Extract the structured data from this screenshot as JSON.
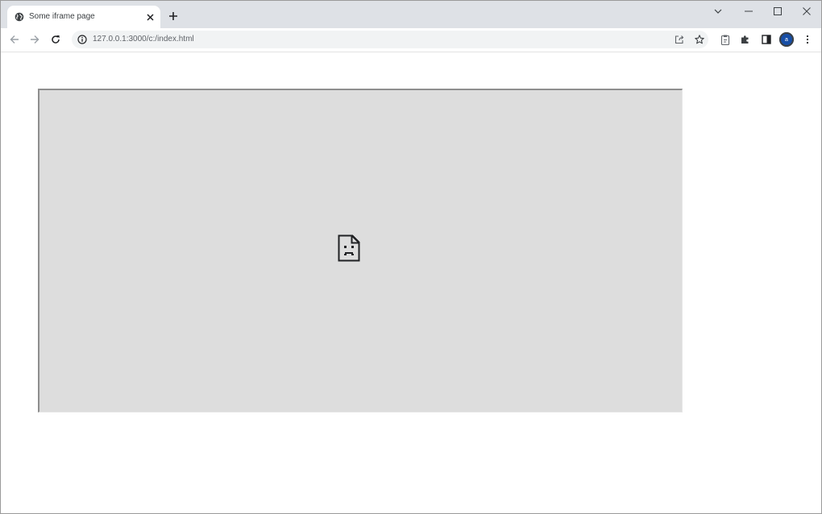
{
  "tab": {
    "title": "Some iframe page",
    "favicon": "globe-icon",
    "close_icon": "close-icon"
  },
  "tabstrip": {
    "new_tab_icon": "plus-icon",
    "search_tabs_icon": "chevron-down-icon"
  },
  "window_controls": {
    "minimize_icon": "minimize-icon",
    "maximize_icon": "maximize-icon",
    "close_icon": "close-icon"
  },
  "toolbar": {
    "back_icon": "arrow-left-icon",
    "forward_icon": "arrow-right-icon",
    "reload_icon": "reload-icon",
    "url": "127.0.0.1:3000/c:/index.html",
    "site_info_icon": "info-icon",
    "share_icon": "share-icon",
    "bookmark_icon": "star-icon",
    "extensions": [
      "clipboard-icon",
      "puzzle-icon",
      "side-panel-icon"
    ],
    "profile_initial": "a",
    "menu_icon": "kebab-menu-icon"
  },
  "content": {
    "iframe_error_icon": "sad-document-icon"
  },
  "colors": {
    "tabstrip_bg": "#dee1e6",
    "omnibox_bg": "#f1f3f4",
    "iframe_bg": "#dddddd",
    "avatar_bg": "#174ea6"
  }
}
